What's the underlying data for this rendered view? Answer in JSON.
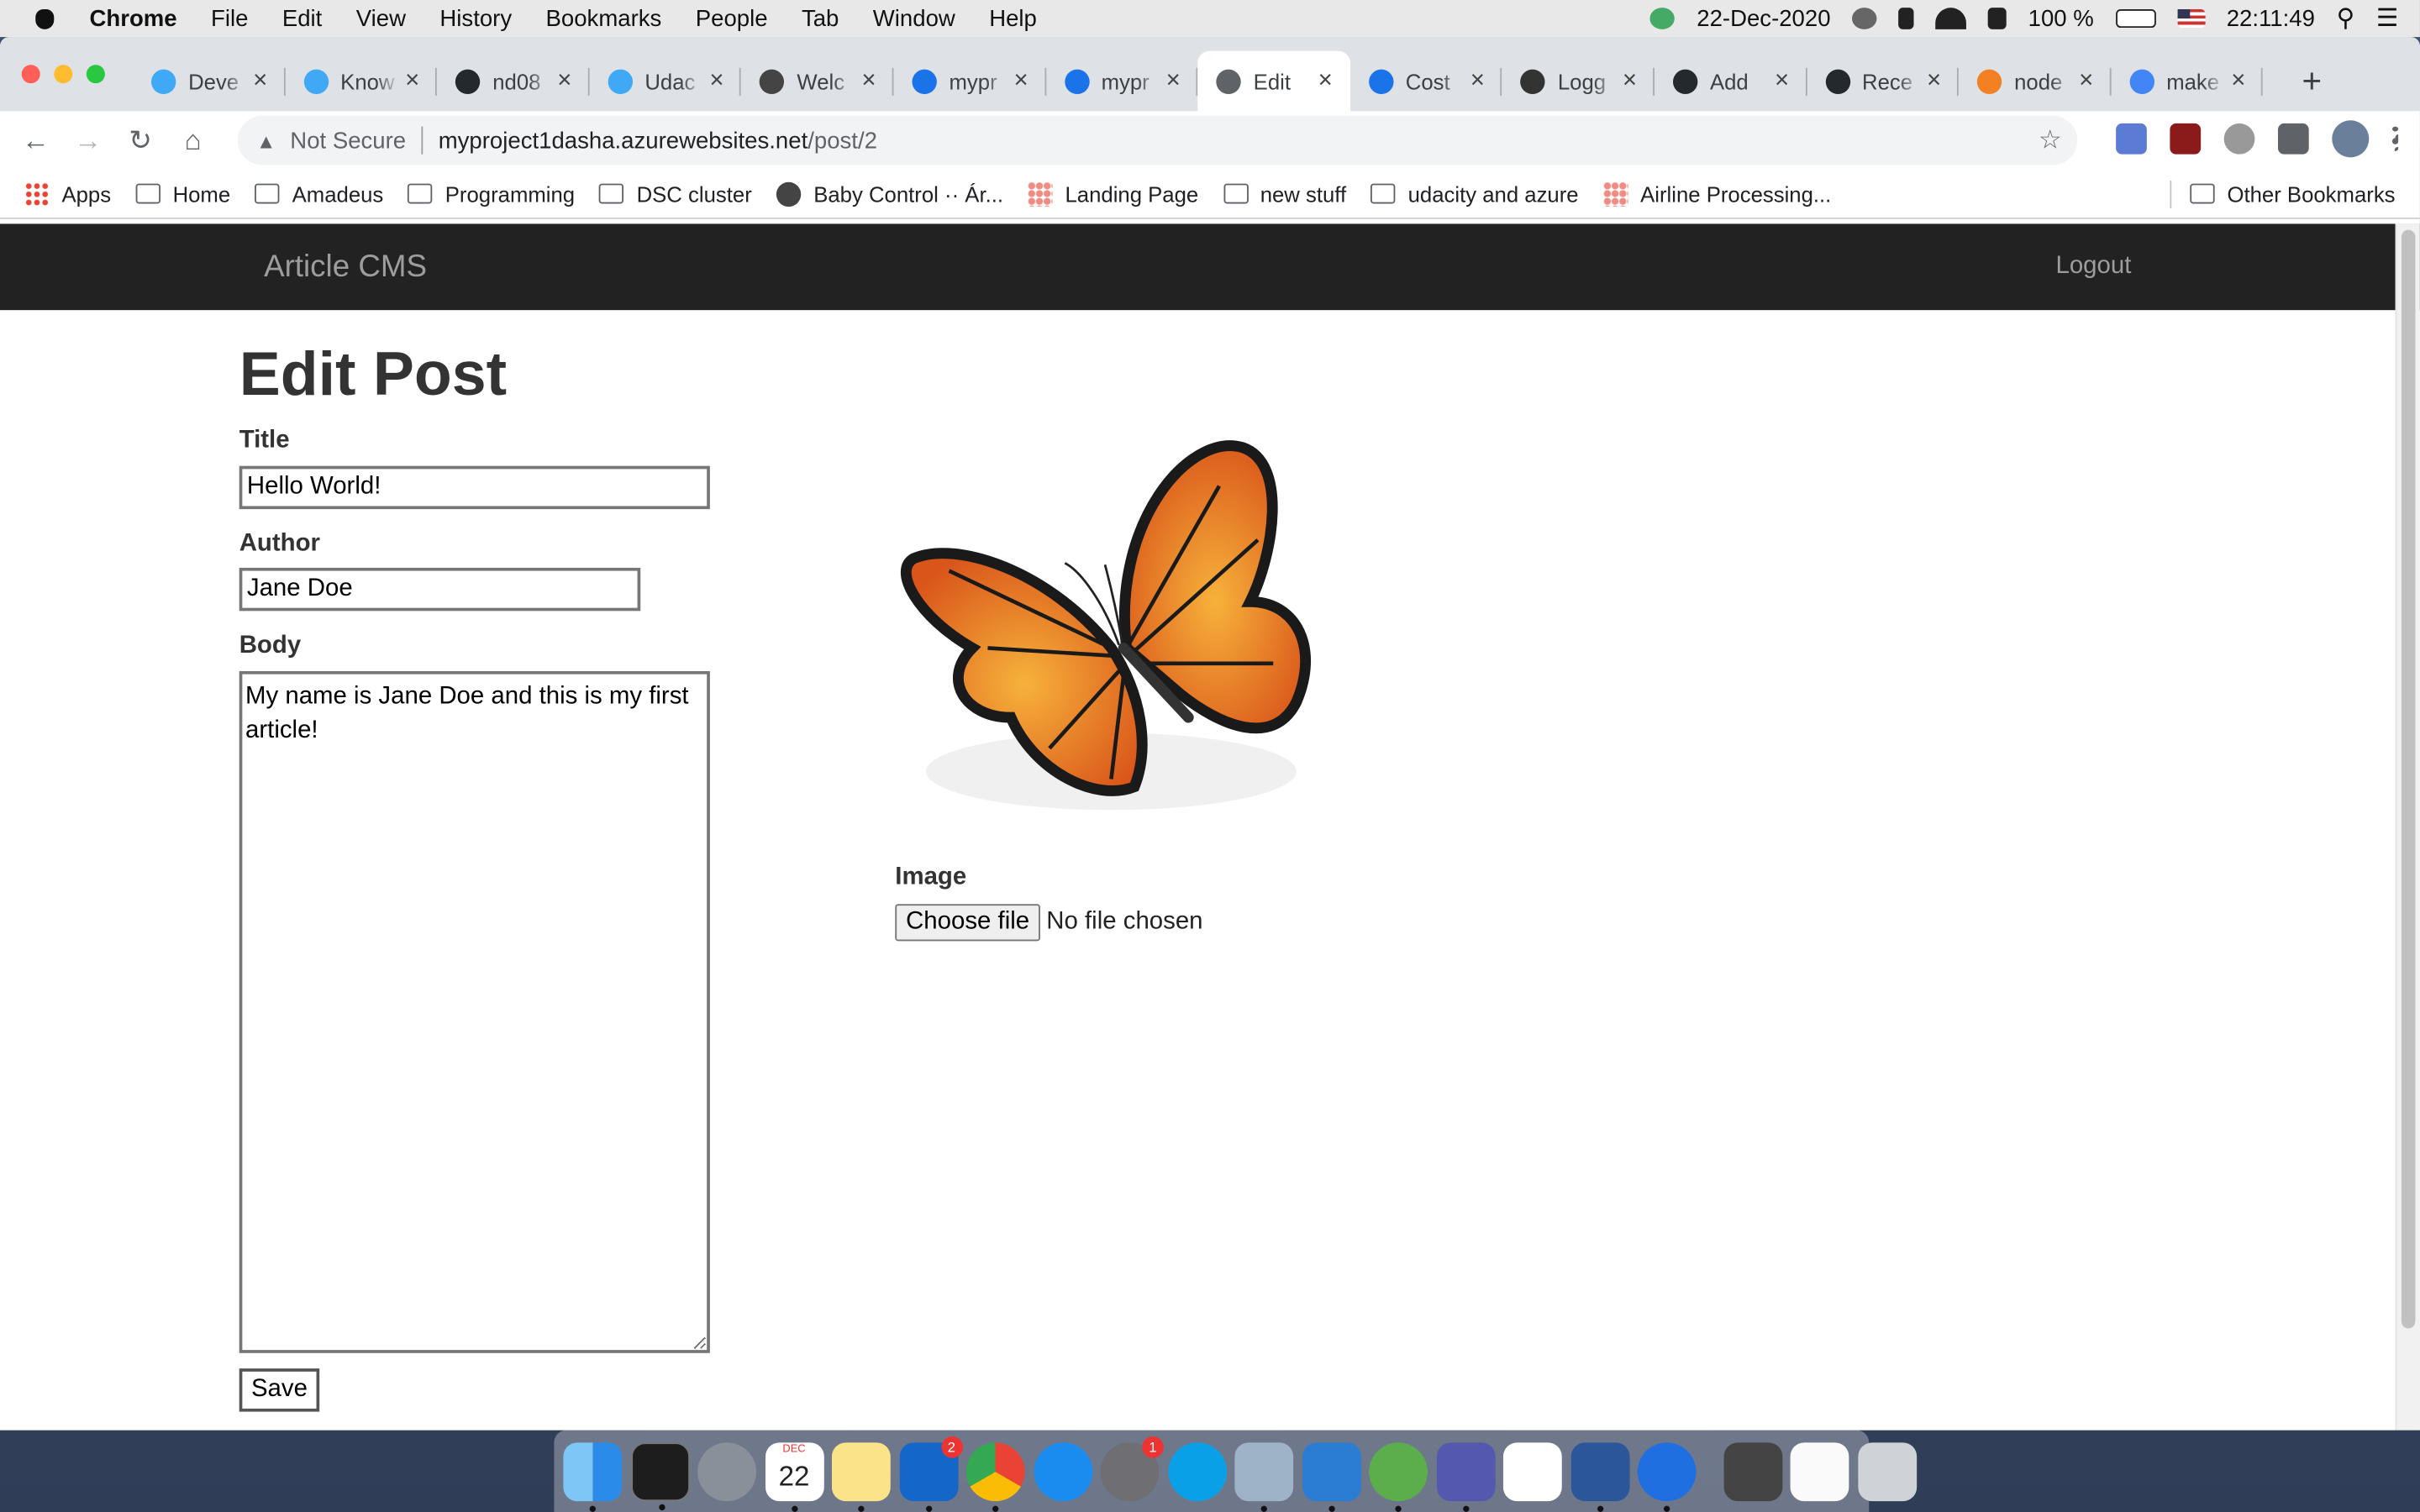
{
  "menubar": {
    "app_name": "Chrome",
    "items": [
      "File",
      "Edit",
      "View",
      "History",
      "Bookmarks",
      "People",
      "Tab",
      "Window",
      "Help"
    ],
    "date": "22-Dec-2020",
    "battery": "100 %",
    "time": "22:11:49"
  },
  "tabs": [
    {
      "title": "Deve",
      "favicon_color": "#3fa9f5"
    },
    {
      "title": "Know",
      "favicon_color": "#3fa9f5"
    },
    {
      "title": "nd08",
      "favicon_color": "#24292e"
    },
    {
      "title": "Udac",
      "favicon_color": "#3fa9f5"
    },
    {
      "title": "Welc",
      "favicon_color": "#444444"
    },
    {
      "title": "mypr",
      "favicon_color": "#1a73e8"
    },
    {
      "title": "mypr",
      "favicon_color": "#1a73e8"
    },
    {
      "title": "Edit",
      "favicon_color": "#5f6368"
    },
    {
      "title": "Cost",
      "favicon_color": "#1a73e8"
    },
    {
      "title": "Logg",
      "favicon_color": "#333333"
    },
    {
      "title": "Add",
      "favicon_color": "#24292e"
    },
    {
      "title": "Rece",
      "favicon_color": "#24292e"
    },
    {
      "title": "node",
      "favicon_color": "#f48024"
    },
    {
      "title": "make",
      "favicon_color": "#4285f4"
    }
  ],
  "address": {
    "security_label": "Not Secure",
    "host": "myproject1dasha.azurewebsites.net",
    "path": "/post/2"
  },
  "bookmarks": {
    "items": [
      {
        "label": "Apps",
        "icon": "apps-grid-icon"
      },
      {
        "label": "Home",
        "icon": "folder-icon"
      },
      {
        "label": "Amadeus",
        "icon": "folder-icon"
      },
      {
        "label": "Programming",
        "icon": "folder-icon"
      },
      {
        "label": "DSC cluster",
        "icon": "folder-icon"
      },
      {
        "label": "Baby Control ·· Ár...",
        "icon": "globe-icon"
      },
      {
        "label": "Landing Page",
        "icon": "spark-icon"
      },
      {
        "label": "new stuff",
        "icon": "folder-icon"
      },
      {
        "label": "udacity and azure",
        "icon": "folder-icon"
      },
      {
        "label": "Airline Processing...",
        "icon": "spark-icon"
      }
    ],
    "other": "Other Bookmarks"
  },
  "site": {
    "brand": "Article CMS",
    "logout": "Logout"
  },
  "form": {
    "heading": "Edit Post",
    "title_label": "Title",
    "title_value": "Hello World!",
    "author_label": "Author",
    "author_value": "Jane Doe",
    "body_label": "Body",
    "body_value": "My name is Jane Doe and this is my first article!",
    "image_label": "Image",
    "choose_file_label": "Choose file",
    "file_status": "No file chosen",
    "save_label": "Save"
  },
  "dock": {
    "calendar_month": "DEC",
    "calendar_day": "22",
    "outlook_badge": "2",
    "settings_badge": "1"
  }
}
